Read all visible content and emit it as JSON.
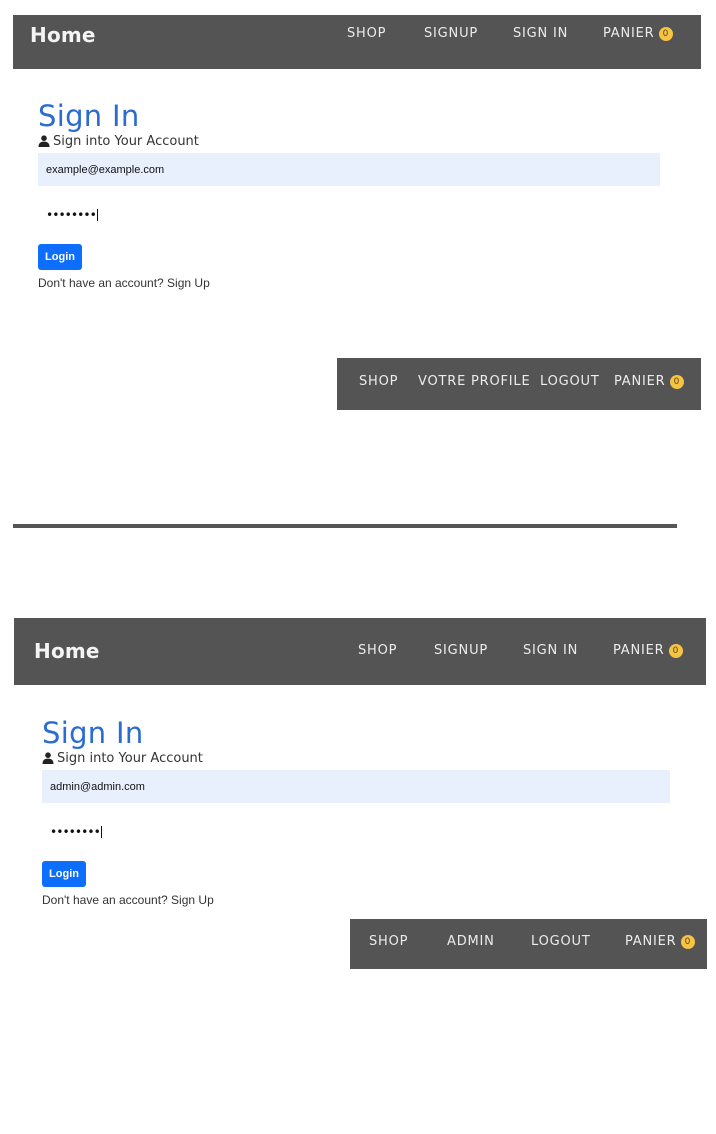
{
  "panel1": {
    "navbar": {
      "brand": "Home",
      "links": [
        "SHOP",
        "SIGNUP",
        "SIGN IN",
        "PANIER"
      ],
      "cart_count": "0"
    },
    "form": {
      "title": "Sign In",
      "lead": "Sign into Your Account",
      "email_value": "example@example.com",
      "password_mask": "••••••••",
      "login_label": "Login",
      "signup_text": "Don't have an account? Sign Up"
    }
  },
  "panel2": {
    "navbar": {
      "links": [
        "SHOP",
        "VOTRE PROFILE",
        "LOGOUT",
        "PANIER"
      ],
      "cart_count": "0"
    }
  },
  "panel3": {
    "navbar": {
      "brand": "Home",
      "links": [
        "SHOP",
        "SIGNUP",
        "SIGN IN",
        "PANIER"
      ],
      "cart_count": "0"
    },
    "form": {
      "title": "Sign In",
      "lead": "Sign into Your Account",
      "email_value": "admin@admin.com",
      "password_mask": "••••••••",
      "login_label": "Login",
      "signup_text": "Don't have an account? Sign Up"
    }
  },
  "panel4": {
    "navbar": {
      "links": [
        "SHOP",
        "ADMIN",
        "LOGOUT",
        "PANIER"
      ],
      "cart_count": "0"
    }
  },
  "colors": {
    "navbar_bg": "#545454",
    "title_blue": "#2a6ccf",
    "button_blue": "#0d6efd",
    "badge_yellow": "#f6c343",
    "input_bg": "#e8f0fe"
  },
  "icons": [
    "user-icon"
  ]
}
